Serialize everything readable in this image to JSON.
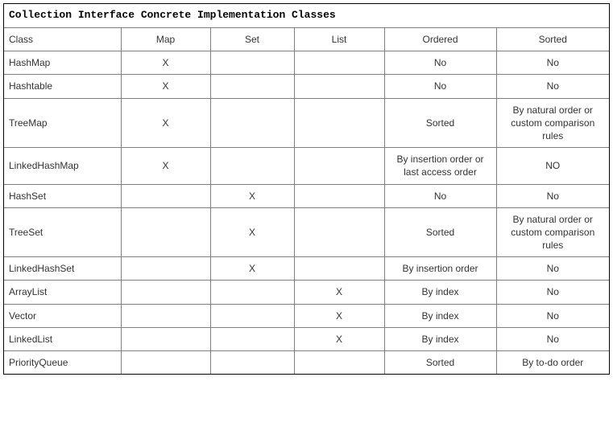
{
  "title": "Collection Interface Concrete Implementation Classes",
  "chart_data": {
    "type": "table",
    "columns": [
      "Class",
      "Map",
      "Set",
      "List",
      "Ordered",
      "Sorted"
    ],
    "rows": [
      {
        "class": "HashMap",
        "map": "X",
        "set": "",
        "list": "",
        "ordered": "No",
        "sorted": "No"
      },
      {
        "class": "Hashtable",
        "map": "X",
        "set": "",
        "list": "",
        "ordered": "No",
        "sorted": "No"
      },
      {
        "class": "TreeMap",
        "map": "X",
        "set": "",
        "list": "",
        "ordered": "Sorted",
        "sorted": "By natural order or custom comparison rules"
      },
      {
        "class": "LinkedHashMap",
        "map": "X",
        "set": "",
        "list": "",
        "ordered": "By insertion order or last access order",
        "sorted": "NO"
      },
      {
        "class": "HashSet",
        "map": "",
        "set": "X",
        "list": "",
        "ordered": "No",
        "sorted": "No"
      },
      {
        "class": "TreeSet",
        "map": "",
        "set": "X",
        "list": "",
        "ordered": "Sorted",
        "sorted": "By natural order or custom comparison rules"
      },
      {
        "class": "LinkedHashSet",
        "map": "",
        "set": "X",
        "list": "",
        "ordered": "By insertion order",
        "sorted": "No"
      },
      {
        "class": "ArrayList",
        "map": "",
        "set": "",
        "list": "X",
        "ordered": "By index",
        "sorted": "No"
      },
      {
        "class": "Vector",
        "map": "",
        "set": "",
        "list": "X",
        "ordered": "By index",
        "sorted": "No"
      },
      {
        "class": "LinkedList",
        "map": "",
        "set": "",
        "list": "X",
        "ordered": "By index",
        "sorted": "No"
      },
      {
        "class": "PriorityQueue",
        "map": "",
        "set": "",
        "list": "",
        "ordered": "Sorted",
        "sorted": "By to-do order"
      }
    ]
  }
}
